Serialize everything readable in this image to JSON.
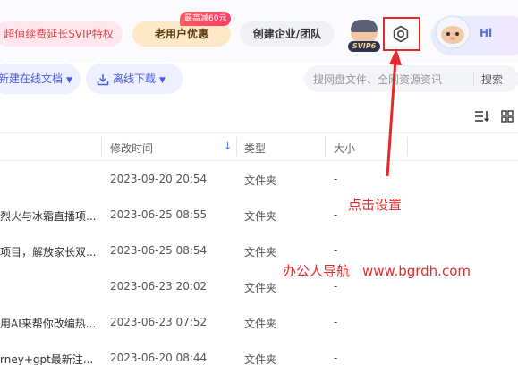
{
  "topbar": {
    "svip_label": "超值续费延长SVIP特权",
    "old_user_label": "老用户优惠",
    "promo_tag": "最高减60元",
    "enterprise_label": "创建企业/团队",
    "avatar_badge": "SVIP6",
    "assistant_label": "Hi"
  },
  "toolbar": {
    "new_doc_label": "新建在线文档",
    "offline_download_label": "离线下载",
    "search_placeholder": "搜网盘文件、全网资源资讯",
    "search_button": "搜索"
  },
  "table": {
    "headers": {
      "modified": "修改时间",
      "type": "类型",
      "size": "大小"
    },
    "rows": [
      {
        "name": "",
        "time": "2023-09-20 20:54",
        "type": "文件夹",
        "size": "-"
      },
      {
        "name": "烈火与冰霜直播项...",
        "time": "2023-06-25 08:55",
        "type": "文件夹",
        "size": "-"
      },
      {
        "name": "项目，解放家长双...",
        "time": "2023-06-25 08:54",
        "type": "文件夹",
        "size": "-"
      },
      {
        "name": "",
        "time": "2023-06-23 20:02",
        "type": "文件夹",
        "size": "-"
      },
      {
        "name": "用AI来帮你改编热...",
        "time": "2023-06-23 07:52",
        "type": "文件夹",
        "size": "-"
      },
      {
        "name": "rney+gpt最新注...",
        "time": "2023-06-20 08:44",
        "type": "文件夹",
        "size": "-"
      }
    ]
  },
  "annotation": {
    "click_settings": "点击设置",
    "watermark_name": "办公人导航",
    "watermark_url": "www.bgrdh.com",
    "color": "#e52a2a"
  },
  "colors": {
    "accent": "#4a5cf0",
    "annotation_red": "#e52a2a"
  }
}
